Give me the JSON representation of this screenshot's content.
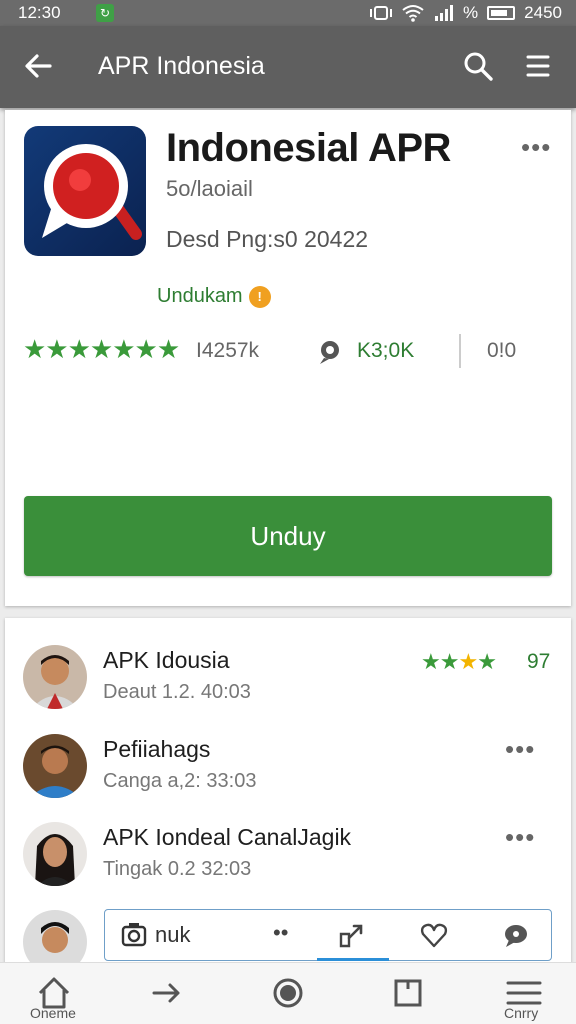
{
  "status_bar": {
    "time": "12:30",
    "right_text": "2450",
    "percent": "%"
  },
  "app_bar": {
    "title": "APR Indonesia"
  },
  "app": {
    "name": "Indonesial APR",
    "developer": "5o/laoiail",
    "date": "Desd Png:s0 20422",
    "unduh_label": "Undukam",
    "reviews": "I4257k",
    "downloads": "K3;0K",
    "size": "0!0",
    "rating_stars": 7,
    "install_label": "Unduy"
  },
  "list": [
    {
      "title": "APK Idousia",
      "subtitle": "Deaut 1.2. 40:03",
      "rating_green": 3,
      "rating_gold": 1,
      "rating_green_after": 1,
      "score": "97"
    },
    {
      "title": "Pefiiahags",
      "subtitle": "Canga a,2: 33:03"
    },
    {
      "title": "APK Iondeal CanalJagik",
      "subtitle": "Tingak 0.2 32:03"
    }
  ],
  "action_bar": {
    "label": "nuk",
    "dots": "••"
  },
  "bottom_nav": [
    {
      "label": "Oneme",
      "icon": "home-icon"
    },
    {
      "label": "",
      "icon": "arrow-right-icon"
    },
    {
      "label": "",
      "icon": "circle-icon"
    },
    {
      "label": "",
      "icon": "square-icon"
    },
    {
      "label": "Cnrry",
      "icon": "list-icon"
    }
  ],
  "colors": {
    "green": "#3a8f3a",
    "appbar": "#5f5f5f",
    "gold": "#f3b400"
  }
}
